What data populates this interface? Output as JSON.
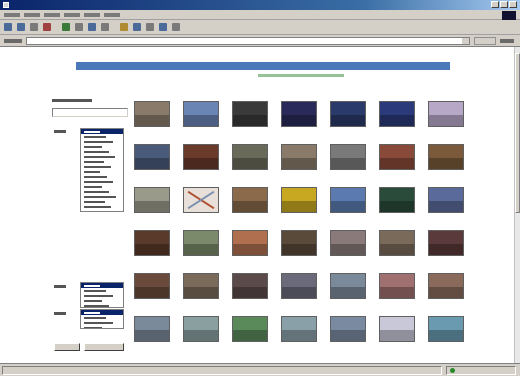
{
  "window": {
    "title": ""
  },
  "browser": {
    "menu_count": 6,
    "toolbar_icon_colors": [
      "#4a6a9a",
      "#4a6a9a",
      "#7a7a7a",
      "#a04040",
      "#3a7a3a",
      "#7a7a7a",
      "#4a6a9a",
      "#7a7a7a",
      "#b08a30",
      "#4a6a9a",
      "#7a7a7a",
      "#4a6a9a",
      "#7a7a7a"
    ],
    "address": "",
    "go_label": "",
    "links_label": ""
  },
  "page": {
    "banner_text": "",
    "subtitle": "",
    "search": {
      "label": "",
      "value": ""
    },
    "filters": [
      {
        "label": "",
        "options": [
          "",
          "",
          "",
          "",
          "",
          "",
          "",
          "",
          "",
          "",
          "",
          "",
          "",
          "",
          "",
          ""
        ],
        "selected": 0
      },
      {
        "label": "",
        "options": [
          "",
          "",
          "",
          "",
          ""
        ],
        "selected": 0
      },
      {
        "label": "",
        "options": [
          "",
          "",
          "",
          ""
        ],
        "selected": 0
      },
      {
        "label": "",
        "options": [
          "",
          "",
          "",
          ""
        ],
        "selected": 0
      },
      {
        "label": "",
        "options": [
          "",
          "",
          "",
          ""
        ],
        "selected": 0
      }
    ],
    "buttons": {
      "search": "",
      "reset": ""
    },
    "thumbnails": [
      [
        "#8a7a6a",
        "#6a84b4",
        "#3a3a3a",
        "#2a2a5a",
        "#2a3a6a",
        "#2a3a7a",
        "#b8a8c8"
      ],
      [
        "#4a5a7a",
        "#6a3a2a",
        "#6a6a5a",
        "#8a7a6a",
        "#7a7a7a",
        "#8a4a3a",
        "#7a5a3a"
      ],
      [
        "#9a9a8a",
        "#e8e0d8",
        "#8a6a4a",
        "#c8a820",
        "#5a7ab0",
        "#2a4a3a",
        "#5a6a9a"
      ],
      [
        "#5a3a2a",
        "#7a8a6a",
        "#b07050",
        "#5a4a3a",
        "#8a7a7a",
        "#7a6a5a",
        "#5a3a3a"
      ],
      [
        "#6a4a3a",
        "#7a6a5a",
        "#5a4a4a",
        "#6a6a7a",
        "#7a8a9a",
        "#a07070",
        "#8a6a5a"
      ],
      [
        "#7a8a9a",
        "#8aa0a0",
        "#5a8a5a",
        "#8aa0a8",
        "#7a8aa0",
        "#c8c8d8",
        "#6a9ab0"
      ]
    ]
  },
  "status": {
    "text": ""
  }
}
